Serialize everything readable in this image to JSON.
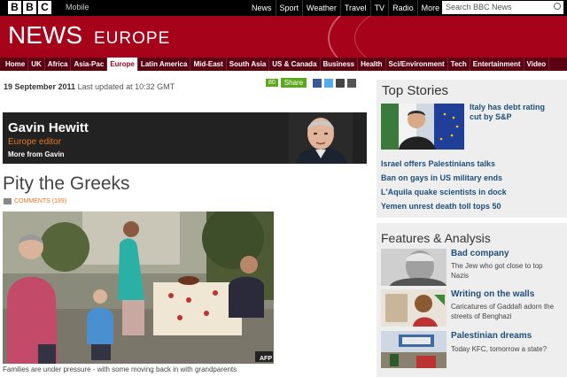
{
  "topbar": {
    "logo_letters": [
      "B",
      "B",
      "C"
    ],
    "mobile": "Mobile",
    "nav": [
      "News",
      "Sport",
      "Weather",
      "Travel",
      "TV",
      "Radio",
      "More"
    ],
    "search_placeholder": "Search BBC News"
  },
  "banner": {
    "title": "NEWS",
    "subtitle": "EUROPE"
  },
  "section_nav": [
    "Home",
    "UK",
    "Africa",
    "Asia-Pac",
    "Europe",
    "Latin America",
    "Mid-East",
    "South Asia",
    "US & Canada",
    "Business",
    "Health",
    "Sci/Environment",
    "Tech",
    "Entertainment",
    "Video"
  ],
  "section_nav_active": "Europe",
  "article": {
    "date": "19 September 2011",
    "updated": "Last updated at 10:32 GMT",
    "share_count": "80",
    "share_label": "Share",
    "blogger_name": "Gavin Hewitt",
    "blogger_role": "Europe editor",
    "blogger_more": "More from Gavin",
    "headline": "Pity the Greeks",
    "comments": "COMMENTS (189)",
    "image_credit": "AFP",
    "caption": "Families are under pressure - with some moving back in with grandparents"
  },
  "top_stories": {
    "heading": "Top Stories",
    "lead": "Italy has debt rating cut by S&P",
    "links": [
      "Israel offers Palestinians talks",
      "Ban on gays in US military ends",
      "L'Aquila quake scientists in dock",
      "Yemen unrest death toll tops 50"
    ]
  },
  "features": {
    "heading": "Features & Analysis",
    "items": [
      {
        "title": "Bad company",
        "desc": "The Jew who got close to top Nazis"
      },
      {
        "title": "Writing on the walls",
        "desc": "Caricatures of Gaddafi adorn the streets of Benghazi"
      },
      {
        "title": "Palestinian dreams",
        "desc": "Today KFC, tomorrow a state?"
      }
    ]
  },
  "colors": {
    "bbc_red": "#a6031a",
    "nav_dark": "#5a0010",
    "link_blue": "#1f4e79",
    "editor_orange": "#e87722",
    "share_green": "#5ca81a"
  }
}
